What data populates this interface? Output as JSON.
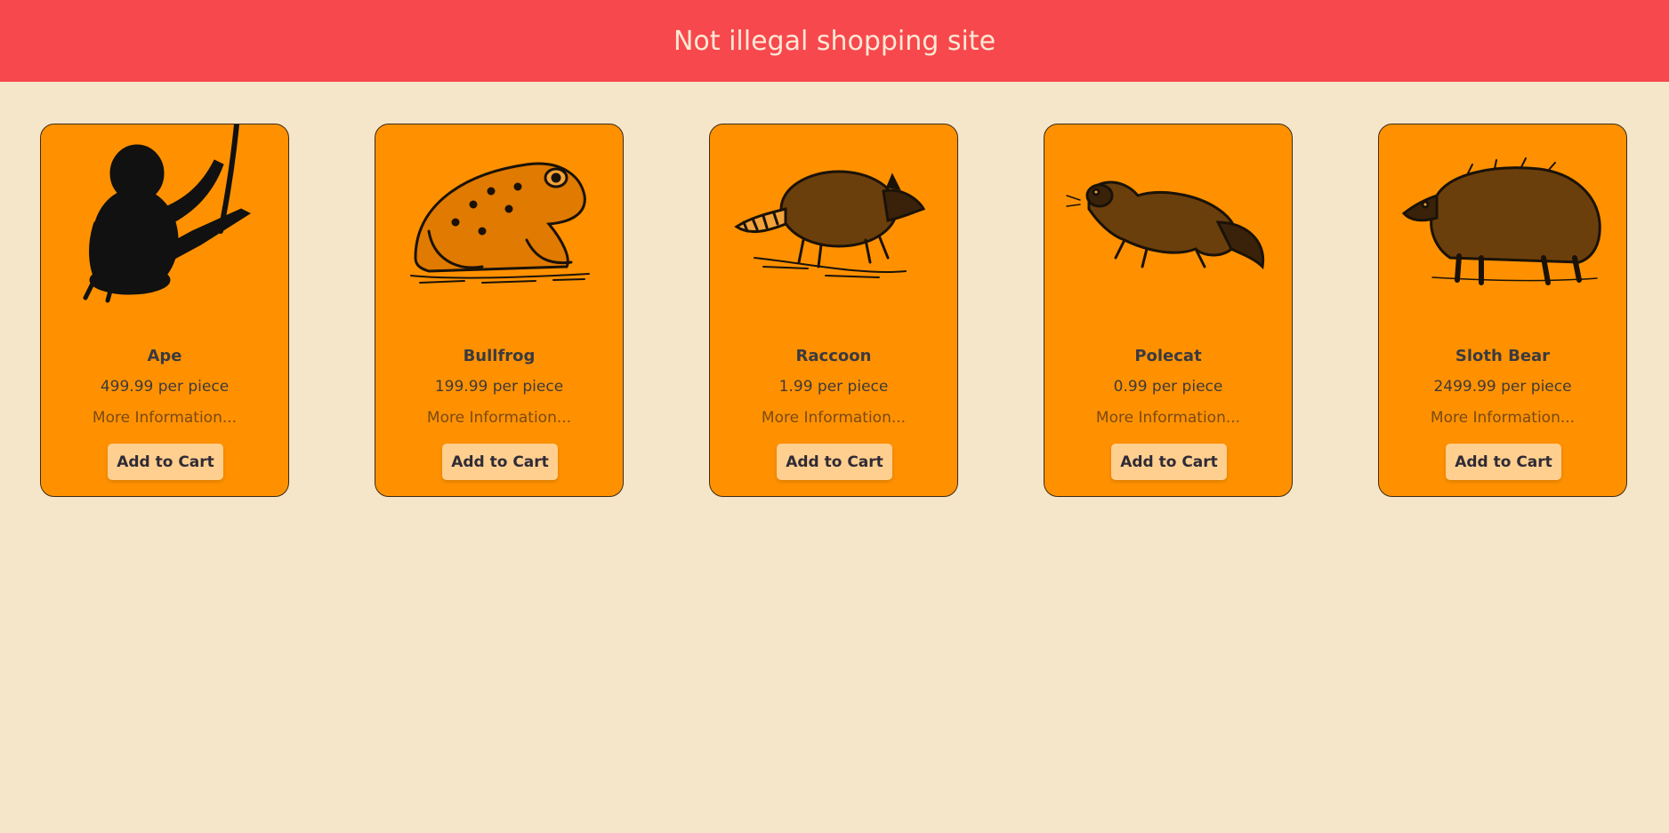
{
  "header": {
    "title": "Not illegal shopping site"
  },
  "theme": {
    "header_bg": "#f7484e",
    "page_bg": "#f6e6c9",
    "card_bg": "#ff9100",
    "button_bg": "#ffcf8f"
  },
  "products": [
    {
      "name": "Ape",
      "price": "499.99 per piece",
      "more": "More Information...",
      "button": "Add to Cart",
      "icon": "ape-illustration"
    },
    {
      "name": "Bullfrog",
      "price": "199.99 per piece",
      "more": "More Information...",
      "button": "Add to Cart",
      "icon": "bullfrog-illustration"
    },
    {
      "name": "Raccoon",
      "price": "1.99 per piece",
      "more": "More Information...",
      "button": "Add to Cart",
      "icon": "raccoon-illustration"
    },
    {
      "name": "Polecat",
      "price": "0.99 per piece",
      "more": "More Information...",
      "button": "Add to Cart",
      "icon": "polecat-illustration"
    },
    {
      "name": "Sloth Bear",
      "price": "2499.99 per piece",
      "more": "More Information...",
      "button": "Add to Cart",
      "icon": "sloth-bear-illustration"
    }
  ]
}
